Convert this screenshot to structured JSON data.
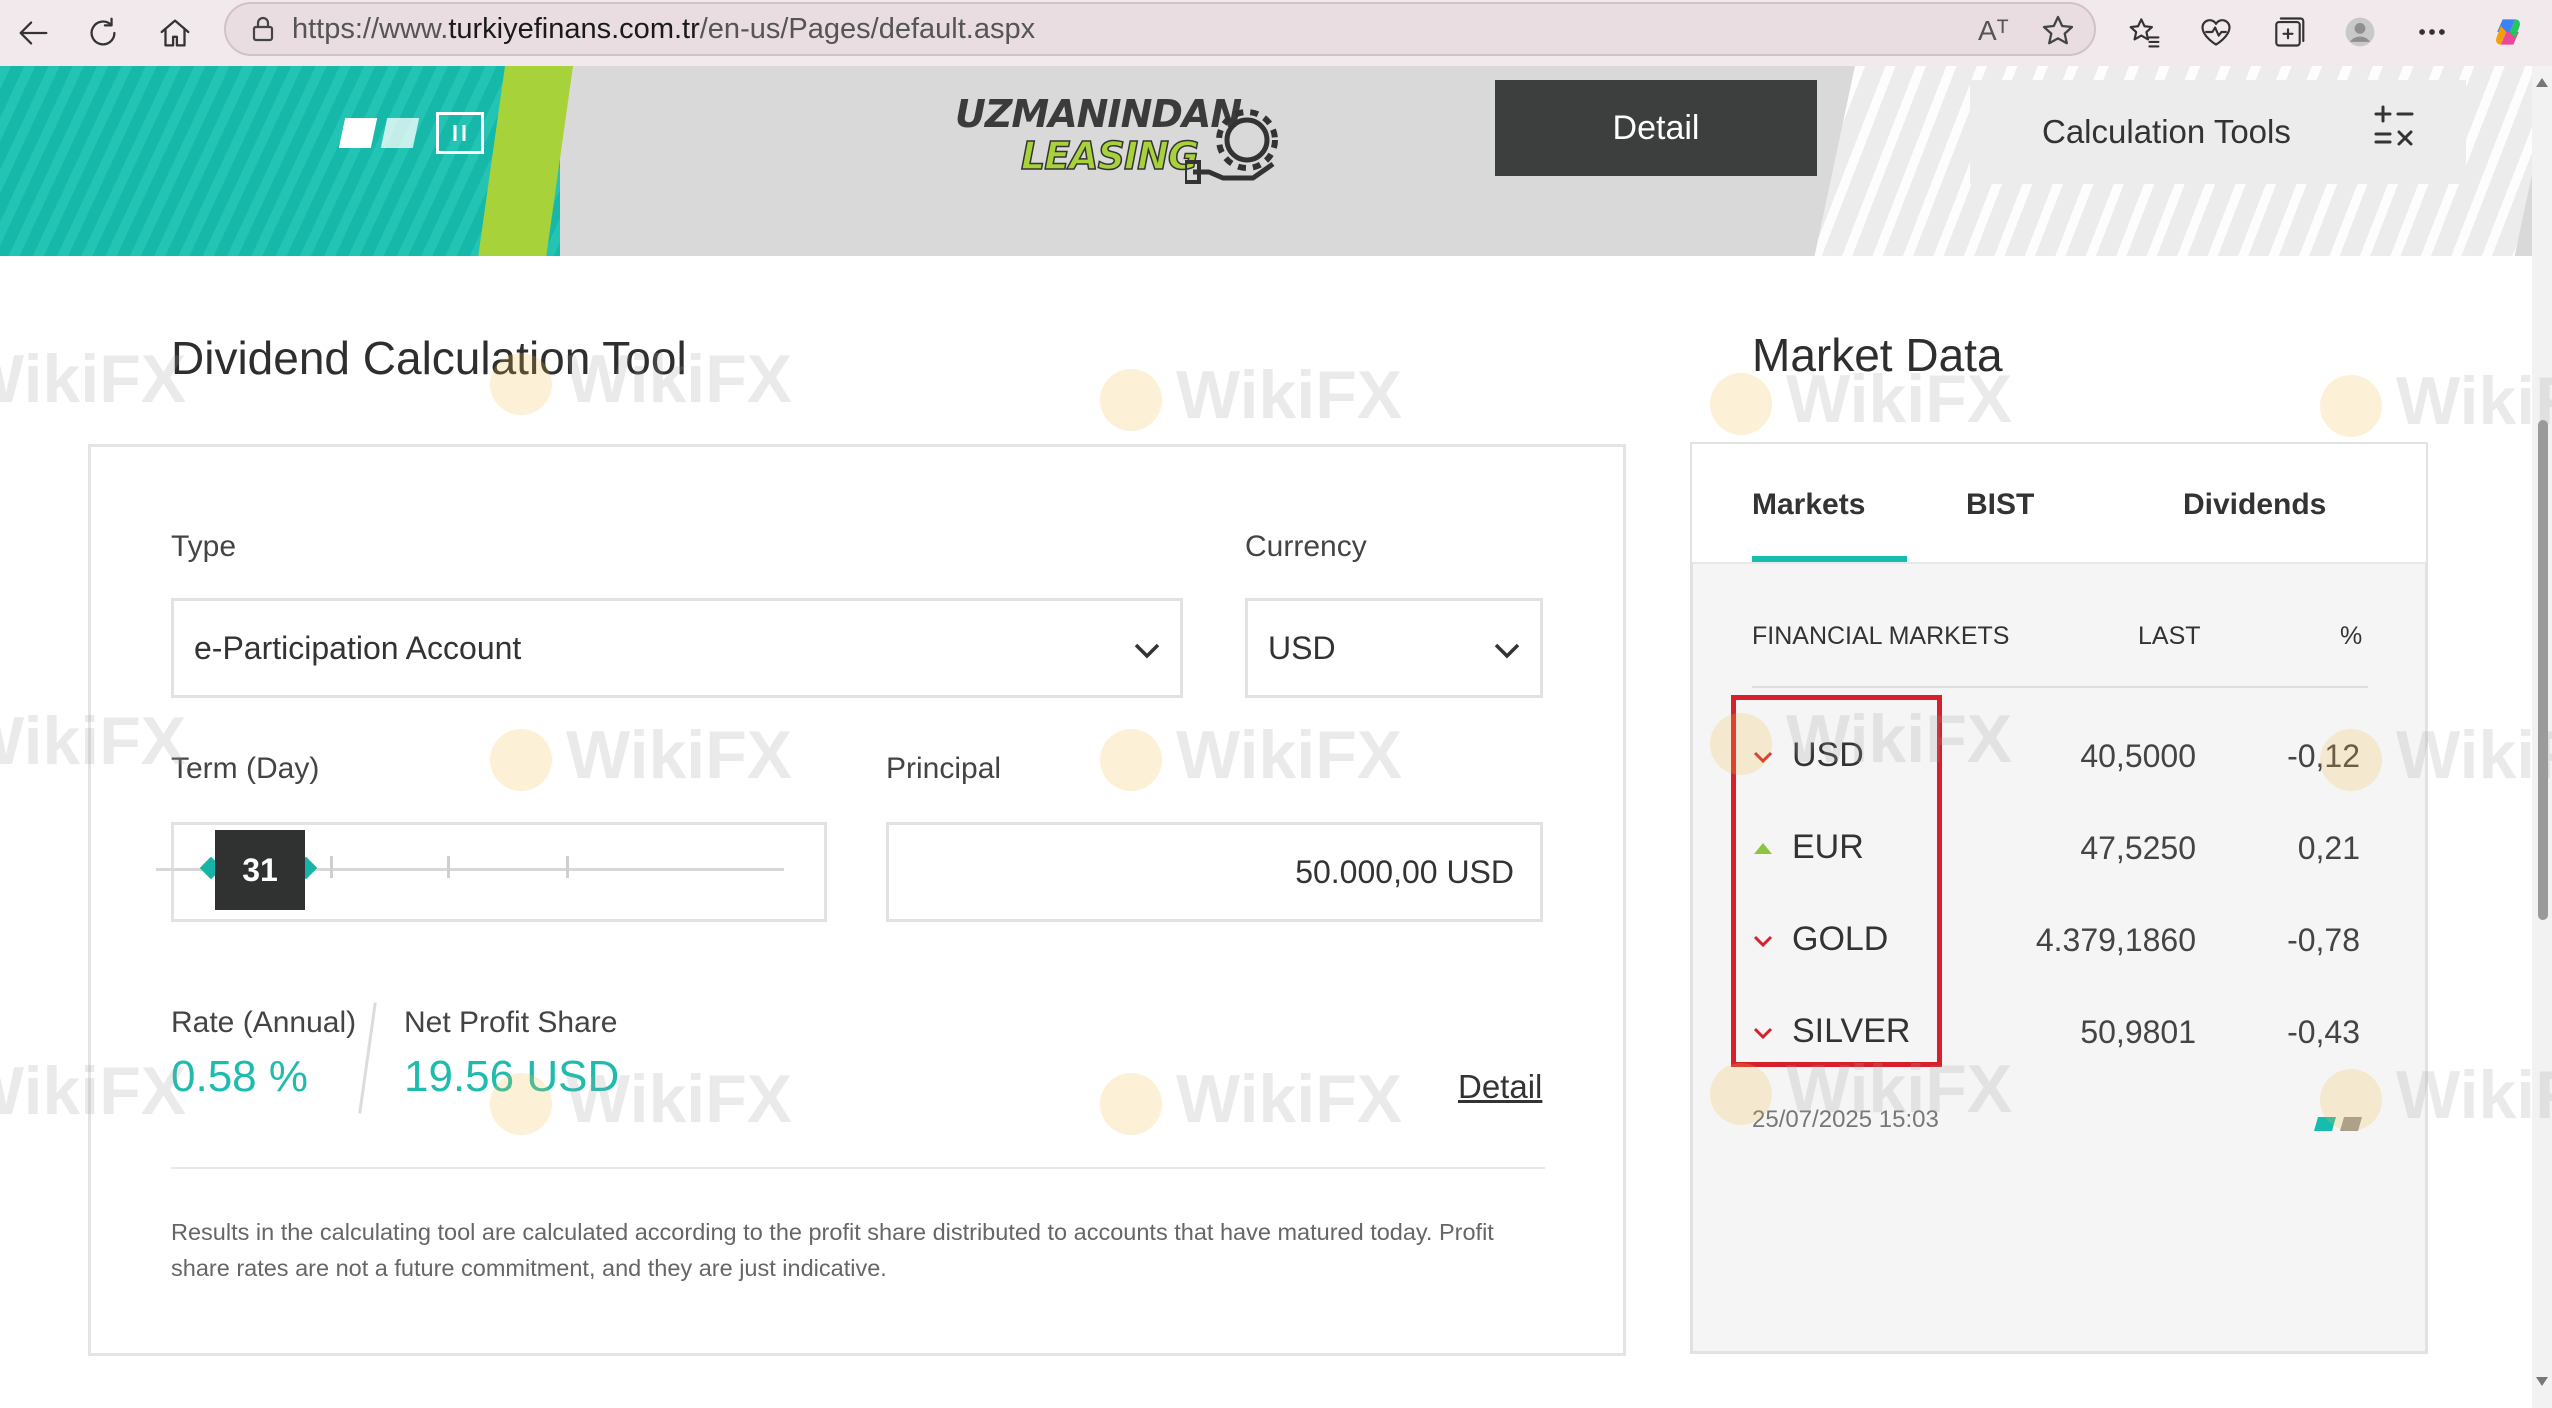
{
  "browser": {
    "url_prefix": "https://www.",
    "url_host": "turkiyefinans.com.tr",
    "url_path": "/en-us/Pages/default.aspx",
    "read_aloud_label": "Aᵀ"
  },
  "banner": {
    "logo_line1": "UZMANINDAN",
    "logo_line2": "LEASING",
    "detail_button": "Detail",
    "calc_tools_label": "Calculation Tools",
    "accent_teal": "#16c0b0",
    "accent_lime": "#a8d23a"
  },
  "calculator": {
    "title": "Dividend Calculation Tool",
    "type_label": "Type",
    "type_value": "e-Participation Account",
    "currency_label": "Currency",
    "currency_value": "USD",
    "term_label": "Term (Day)",
    "term_value": "31",
    "principal_label": "Principal",
    "principal_value": "50.000,00 USD",
    "rate_label": "Rate (Annual)",
    "rate_value": "0.58 %",
    "profit_label": "Net Profit Share",
    "profit_value": "19.56 USD",
    "detail_link": "Detail",
    "disclaimer": "Results in the calculating tool are calculated according to the profit share distributed to accounts that have matured today. Profit share rates are not a future commitment, and they are just indicative."
  },
  "market": {
    "title": "Market Data",
    "tabs": [
      "Markets",
      "BIST",
      "Dividends"
    ],
    "active_tab": "Markets",
    "headers": {
      "name": "FINANCIAL MARKETS",
      "last": "LAST",
      "pct": "%"
    },
    "rows": [
      {
        "name": "USD",
        "last": "40,5000",
        "pct": "-0,12",
        "trend": "down"
      },
      {
        "name": "EUR",
        "last": "47,5250",
        "pct": "0,21",
        "trend": "up"
      },
      {
        "name": "GOLD",
        "last": "4.379,1860",
        "pct": "-0,78",
        "trend": "down"
      },
      {
        "name": "SILVER",
        "last": "50,9801",
        "pct": "-0,43",
        "trend": "down"
      }
    ],
    "timestamp": "25/07/2025 15:03",
    "down_color": "#d6202c",
    "up_color": "#8cc63f",
    "highlight_color": "#d6202c"
  },
  "watermark": {
    "text": "WikiFX"
  }
}
